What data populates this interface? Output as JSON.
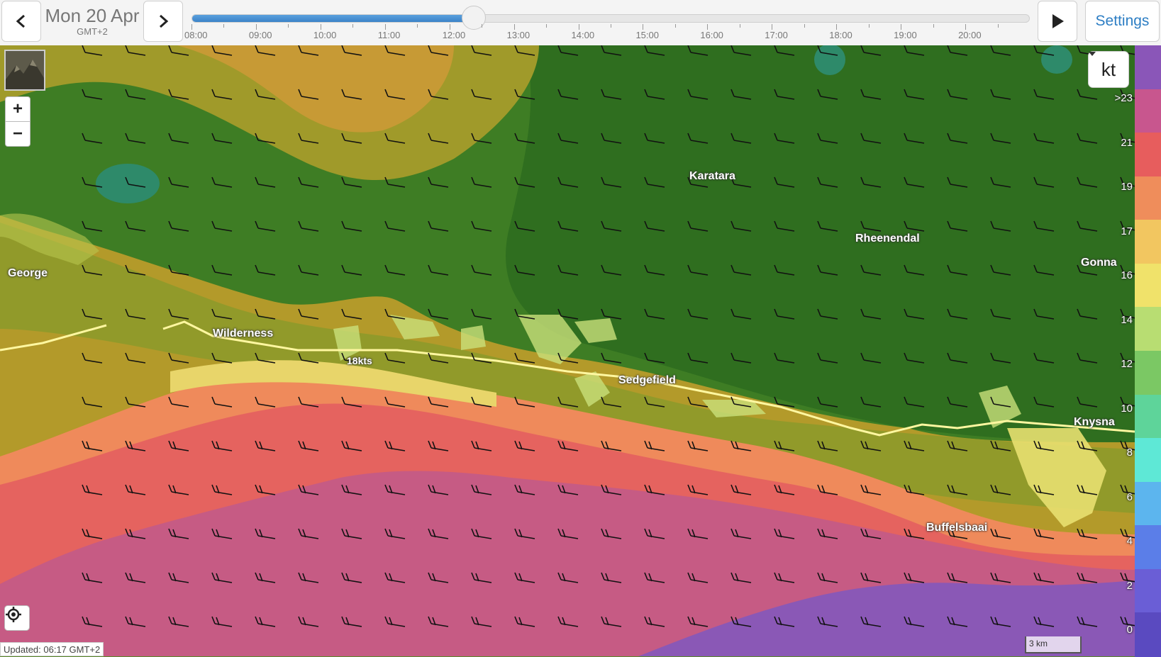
{
  "header": {
    "date": "Mon 20 Apr",
    "timezone": "GMT+2",
    "prev_icon": "chevron-left-icon",
    "next_icon": "chevron-right-icon",
    "play_icon": "play-icon",
    "settings_label": "Settings"
  },
  "timeline": {
    "hours": [
      "08:00",
      "09:00",
      "10:00",
      "11:00",
      "12:00",
      "13:00",
      "14:00",
      "15:00",
      "16:00",
      "17:00",
      "18:00",
      "19:00",
      "20:00"
    ],
    "current": "12:00",
    "progress_fraction": 0.337
  },
  "map": {
    "places": [
      "George",
      "Wilderness",
      "Karatara",
      "Rheenendal",
      "Sedgefield",
      "Gonna",
      "Knysna",
      "Buffelsbaai"
    ],
    "wind_label": "18kts",
    "zoom_in_label": "+",
    "zoom_out_label": "−",
    "layer_icon": "terrain-layer-icon",
    "locate_icon": "locate-icon"
  },
  "units": {
    "selected": "kt",
    "dropdown_icon": "caret-down-icon"
  },
  "legend": {
    "labels": [
      ">23",
      "21",
      "19",
      "17",
      "16",
      "14",
      "12",
      "10",
      "8",
      "6",
      "4",
      "2",
      "0"
    ],
    "colors": [
      "#8a56b8",
      "#c8568e",
      "#e75d5d",
      "#ef8d5b",
      "#f2c660",
      "#f0e26a",
      "#b8dd72",
      "#7bc864",
      "#5ed49a",
      "#5ee8d6",
      "#5cb5ee",
      "#5b7ee8",
      "#6a5ed6",
      "#5a4ac0"
    ]
  },
  "footer": {
    "updated": "Updated: 06:17 GMT+2",
    "scale": "3 km"
  }
}
